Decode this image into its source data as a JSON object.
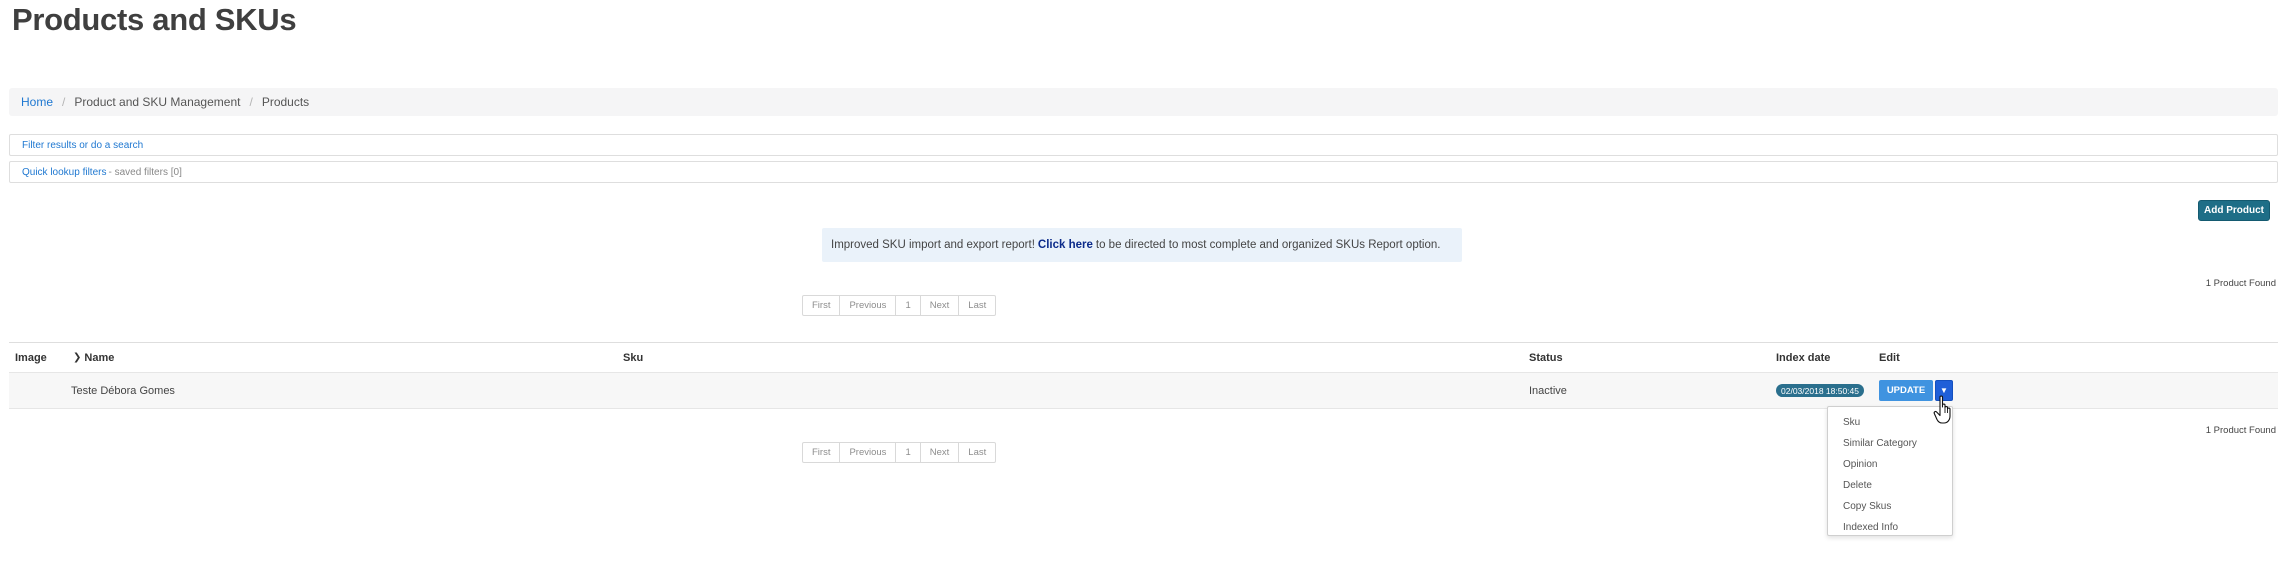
{
  "page": {
    "title": "Products and SKUs"
  },
  "breadcrumb": {
    "home": "Home",
    "management": "Product and SKU Management",
    "current": "Products",
    "separator": "/"
  },
  "filters": {
    "search_link": "Filter results or do a search",
    "quick_link": "Quick lookup filters",
    "saved_text": "- saved filters [0]"
  },
  "toolbar": {
    "add_product": "Add Product"
  },
  "notice": {
    "before": "Improved SKU import and export report!",
    "link": "Click here",
    "after": "to be directed to most complete and organized SKUs Report option."
  },
  "results": {
    "count_text": "1 Product Found"
  },
  "pagination": {
    "first": "First",
    "previous": "Previous",
    "page": "1",
    "next": "Next",
    "last": "Last"
  },
  "table": {
    "headers": {
      "image": "Image",
      "name": "Name",
      "sku": "Sku",
      "status": "Status",
      "index_date": "Index date",
      "edit": "Edit"
    },
    "rows": [
      {
        "name": "Teste Débora Gomes",
        "sku": "",
        "status": "Inactive",
        "index_date": "02/03/2018 18:50:45"
      }
    ]
  },
  "row_actions": {
    "update": "UPDATE",
    "menu": [
      "Sku",
      "Similar Category",
      "Opinion",
      "Delete",
      "Copy Skus",
      "Indexed Info"
    ]
  },
  "colors": {
    "link": "#1f78d1",
    "update_button": "#3f93e0",
    "add_button": "#1e6e87",
    "notice_bg": "#eaf2fa"
  }
}
